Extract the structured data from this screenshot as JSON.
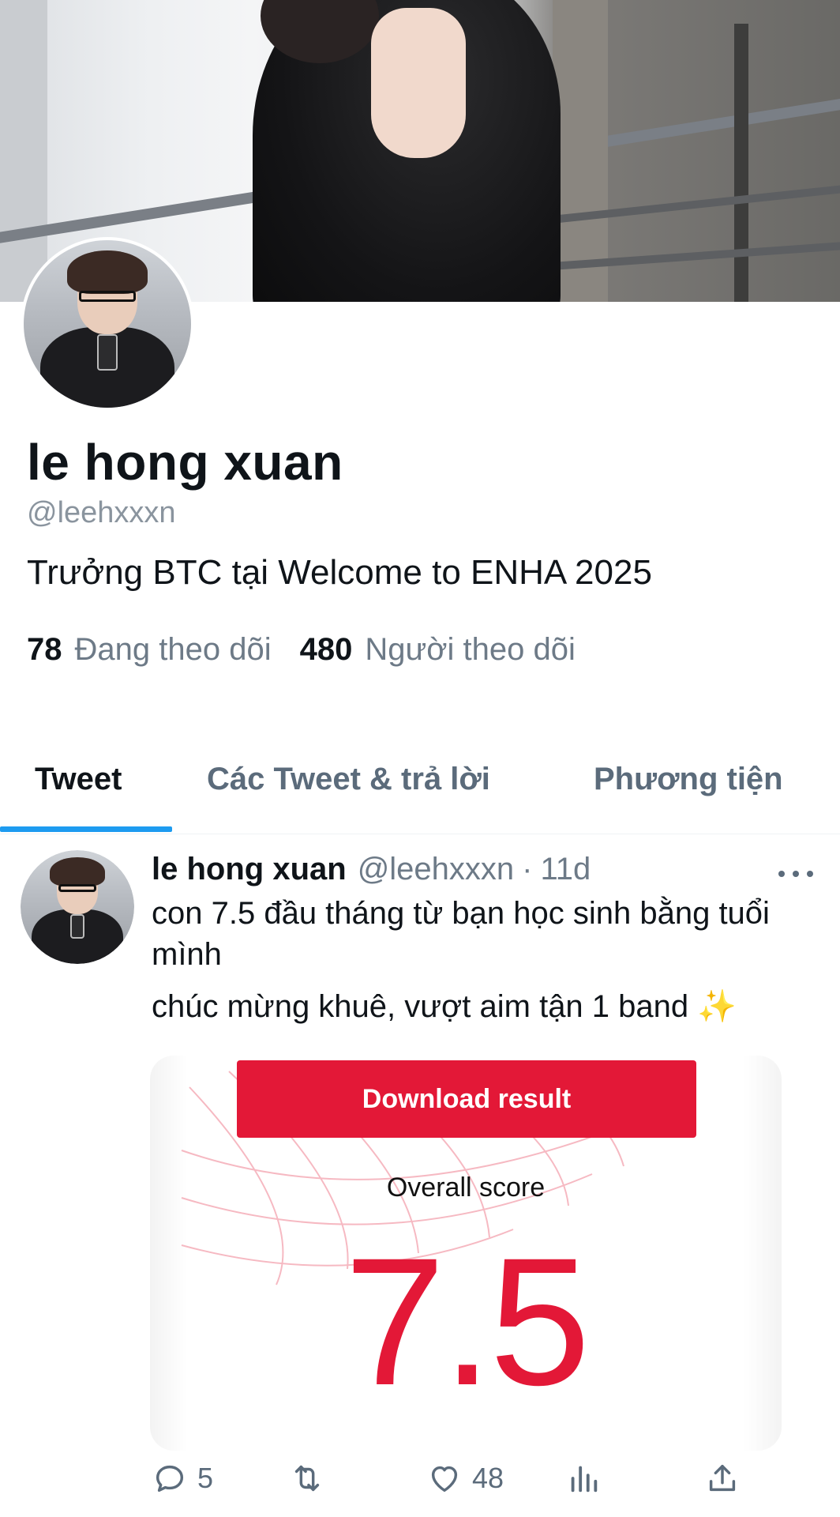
{
  "profile": {
    "display_name": "le hong xuan",
    "handle": "@leehxxxn",
    "bio": "Trưởng BTC tại Welcome to ENHA 2025",
    "following_count": "78",
    "following_label": "Đang theo dõi",
    "followers_count": "480",
    "followers_label": "Người theo dõi"
  },
  "tabs": [
    {
      "label": "Tweet",
      "active": true
    },
    {
      "label": "Các Tweet & trả lời",
      "active": false
    },
    {
      "label": "Phương tiện",
      "active": false
    }
  ],
  "tweet": {
    "name": "le hong xuan",
    "handle": "@leehxxxn",
    "separator": "·",
    "time": "11d",
    "text_line1": "con 7.5 đầu tháng từ bạn học sinh bằng tuổi mình",
    "text_line2": "chúc mừng khuê, vượt aim tận 1 band ✨",
    "media": {
      "button_label": "Download result",
      "overall_label": "Overall score",
      "score": "7.5"
    },
    "actions": {
      "reply_count": "5",
      "retweet_count": "",
      "like_count": "48"
    }
  },
  "icons": {
    "more": "more-horizontal-icon",
    "reply": "reply-icon",
    "retweet": "retweet-icon",
    "like": "heart-icon",
    "views": "views-chart-icon",
    "share": "share-icon"
  },
  "colors": {
    "accent": "#1d9bf0",
    "score_red": "#e31837",
    "muted": "#6d7a87"
  }
}
